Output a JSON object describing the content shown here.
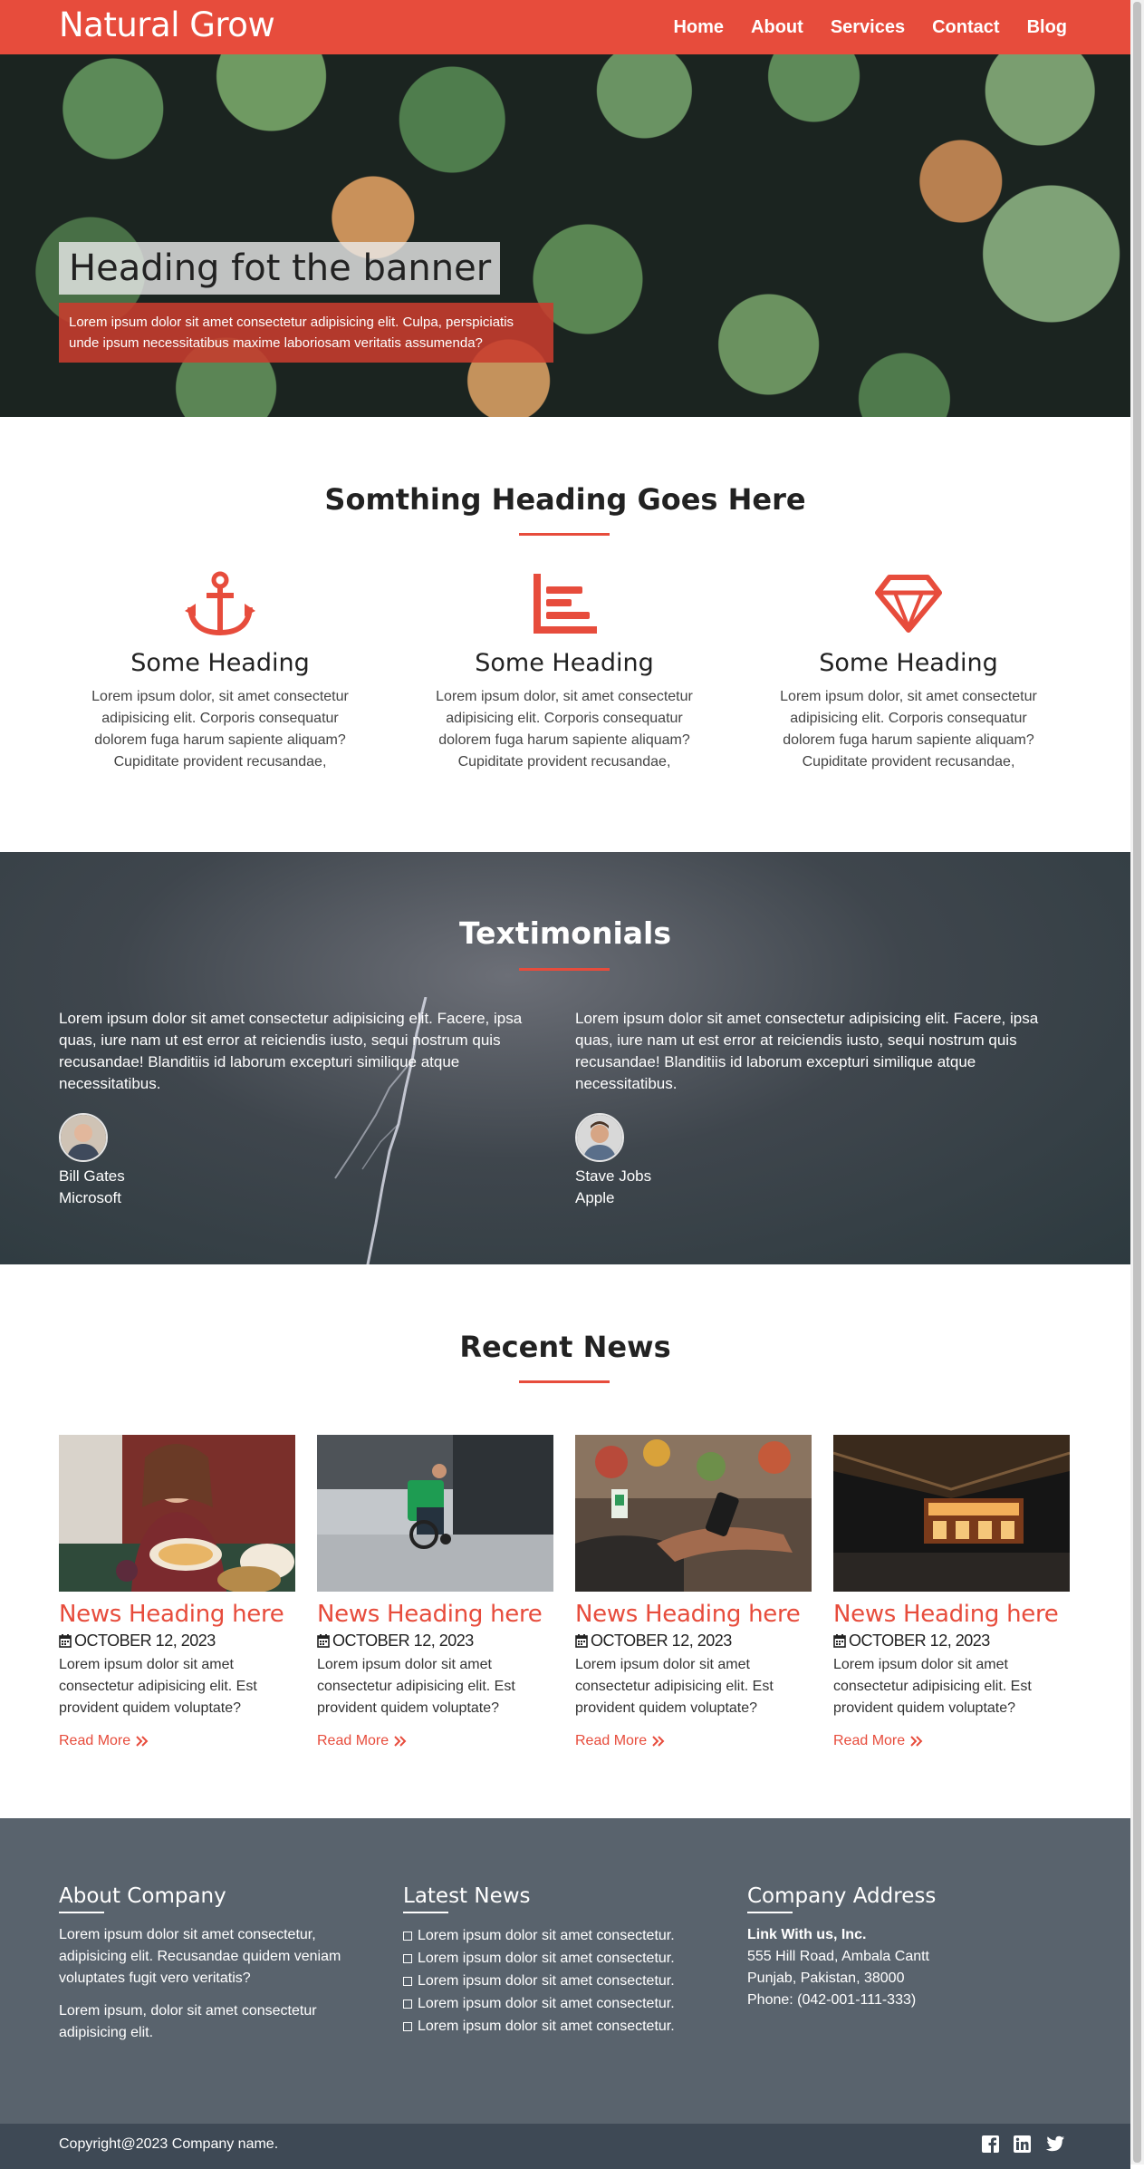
{
  "nav": {
    "brand": "Natural Grow",
    "links": [
      "Home",
      "About",
      "Services",
      "Contact",
      "Blog"
    ]
  },
  "banner": {
    "title": "Heading fot the banner",
    "text": "Lorem ipsum dolor sit amet consectetur adipisicing elit. Culpa, perspiciatis unde ipsum necessitatibus maxime laboriosam veritatis assumenda?"
  },
  "features": {
    "title": "Somthing Heading Goes Here",
    "items": [
      {
        "icon": "anchor-icon",
        "heading": "Some Heading",
        "text": "Lorem ipsum dolor, sit amet consectetur adipisicing elit. Corporis consequatur dolorem fuga harum sapiente aliquam? Cupiditate provident recusandae,"
      },
      {
        "icon": "bar-chart-icon",
        "heading": "Some Heading",
        "text": "Lorem ipsum dolor, sit amet consectetur adipisicing elit. Corporis consequatur dolorem fuga harum sapiente aliquam? Cupiditate provident recusandae,"
      },
      {
        "icon": "diamond-icon",
        "heading": "Some Heading",
        "text": "Lorem ipsum dolor, sit amet consectetur adipisicing elit. Corporis consequatur dolorem fuga harum sapiente aliquam? Cupiditate provident recusandae,"
      }
    ]
  },
  "testimonials": {
    "title": "Textimonials",
    "items": [
      {
        "quote": "Lorem ipsum dolor sit amet consectetur adipisicing elit. Facere, ipsa quas, iure nam ut est error at reiciendis iusto, sequi nostrum quis recusandae! Blanditiis id laborum excepturi similique atque necessitatibus.",
        "name": "Bill Gates",
        "company": "Microsoft"
      },
      {
        "quote": "Lorem ipsum dolor sit amet consectetur adipisicing elit. Facere, ipsa quas, iure nam ut est error at reiciendis iusto, sequi nostrum quis recusandae! Blanditiis id laborum excepturi similique atque necessitatibus.",
        "name": "Stave Jobs",
        "company": "Apple"
      }
    ]
  },
  "news": {
    "title": "Recent News",
    "items": [
      {
        "heading": "News Heading here",
        "date": "OCTOBER 12, 2023",
        "text": "Lorem ipsum dolor sit amet consectetur adipisicing elit. Est provident quidem voluptate?",
        "more": "Read More"
      },
      {
        "heading": "News Heading here",
        "date": "OCTOBER 12, 2023",
        "text": "Lorem ipsum dolor sit amet consectetur adipisicing elit. Est provident quidem voluptate?",
        "more": "Read More"
      },
      {
        "heading": "News Heading here",
        "date": "OCTOBER 12, 2023",
        "text": "Lorem ipsum dolor sit amet consectetur adipisicing elit. Est provident quidem voluptate?",
        "more": "Read More"
      },
      {
        "heading": "News Heading here",
        "date": "OCTOBER 12, 2023",
        "text": "Lorem ipsum dolor sit amet consectetur adipisicing elit. Est provident quidem voluptate?",
        "more": "Read More"
      }
    ]
  },
  "footer": {
    "about": {
      "title": "About Company",
      "p1": "Lorem ipsum dolor sit amet consectetur, adipisicing elit. Recusandae quidem veniam voluptates fugit vero veritatis?",
      "p2": "Lorem ipsum, dolor sit amet consectetur adipisicing elit."
    },
    "latest": {
      "title": "Latest News",
      "items": [
        "Lorem ipsum dolor sit amet consectetur.",
        "Lorem ipsum dolor sit amet consectetur.",
        "Lorem ipsum dolor sit amet consectetur.",
        "Lorem ipsum dolor sit amet consectetur.",
        "Lorem ipsum dolor sit amet consectetur."
      ]
    },
    "address": {
      "title": "Company Address",
      "company": "Link With us, Inc.",
      "street": "555 Hill Road, Ambala Cantt",
      "city": "Punjab, Pakistan, 38000",
      "phone": "Phone: (042-001-111-333)"
    },
    "copyright": "Copyright@2023 Company name.",
    "social": [
      "facebook-icon",
      "linkedin-icon",
      "twitter-icon"
    ]
  },
  "colors": {
    "accent": "#e74c3c",
    "footer": "#59636d",
    "copybar": "#3e4955"
  }
}
